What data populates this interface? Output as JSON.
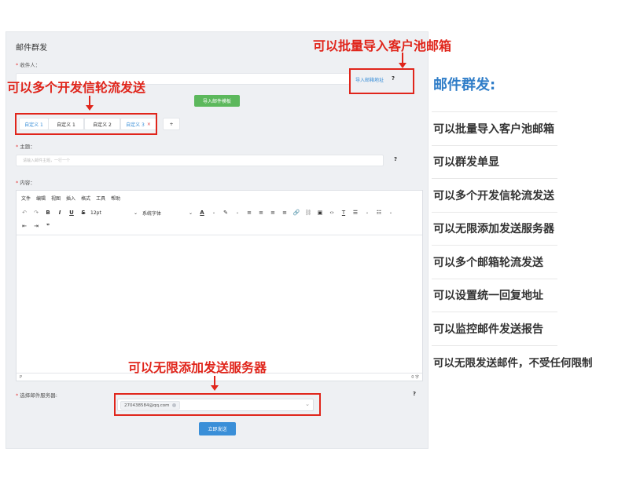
{
  "form": {
    "title": "邮件群发",
    "recipient_label": "收件人：",
    "import_link": "导入邮箱地址",
    "template_button": "导入邮件模板",
    "tabs": [
      {
        "label": "自定义 1",
        "active": true
      },
      {
        "label": "自定义 1",
        "active": false
      },
      {
        "label": "自定义 2",
        "active": false
      },
      {
        "label": "自定义 3",
        "active": true,
        "close": "×"
      }
    ],
    "add_tab": "+",
    "subject_label": "主题：",
    "subject_placeholder": "请输入邮件主题，一行一个",
    "content_label": "内容：",
    "server_label": "选择邮件服务器:",
    "server_tag": "270438584@qq.com",
    "send_button": "立即发送"
  },
  "editor": {
    "menu": [
      "文件",
      "编辑",
      "视图",
      "插入",
      "格式",
      "工具",
      "帮助"
    ],
    "toolbar": {
      "undo": "↶",
      "redo": "↷",
      "bold": "B",
      "italic": "I",
      "underline": "U",
      "strike": "S",
      "font_size": "12pt",
      "font_family": "系统字体",
      "text_color": "A",
      "highlight": "✎",
      "indent_out": "⇤",
      "indent_in": "⇥",
      "quote": "❞"
    },
    "status_left": "P",
    "status_right": "0 字"
  },
  "help_icon": "?",
  "annotations": {
    "import": "可以批量导入客户池邮箱",
    "multi_sender": "可以多个开发信轮流发送",
    "servers": "可以无限添加发送服务器"
  },
  "features": {
    "title": "邮件群发:",
    "items": [
      "可以批量导入客户池邮箱",
      "可以群发单显",
      "可以多个开发信轮流发送",
      "可以无限添加发送服务器",
      "可以多个邮箱轮流发送",
      "可以设置统一回复地址",
      "可以监控邮件发送报告",
      "可以无限发送邮件，不受任何限制"
    ]
  },
  "colors": {
    "annotation_red": "#e0251b",
    "title_blue": "#2f7dc8",
    "link_blue": "#3a8fd8",
    "green_button": "#5cb85c"
  }
}
